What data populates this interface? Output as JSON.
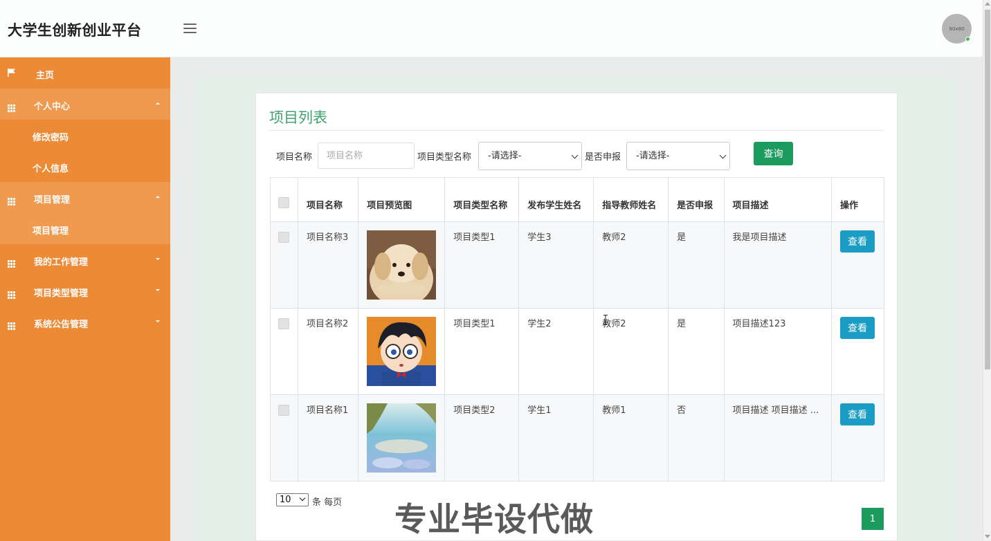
{
  "header": {
    "brand": "大学生创新创业平台",
    "avatar_text": "80x80"
  },
  "sidebar": {
    "items": [
      {
        "label": "主页",
        "icon": "flag-icon"
      },
      {
        "label": "个人中心",
        "icon": "grid-icon",
        "expanded": true,
        "children": [
          "修改密码",
          "个人信息"
        ]
      },
      {
        "label": "项目管理",
        "icon": "grid-icon",
        "expanded": true,
        "children": [
          "项目管理"
        ]
      },
      {
        "label": "我的工作管理",
        "icon": "grid-icon",
        "expanded": false
      },
      {
        "label": "项目类型管理",
        "icon": "grid-icon",
        "expanded": false
      },
      {
        "label": "系统公告管理",
        "icon": "grid-icon",
        "expanded": false
      }
    ]
  },
  "main": {
    "title": "项目列表",
    "search": {
      "name_label": "项目名称",
      "name_placeholder": "项目名称",
      "type_label": "项目类型名称",
      "type_select": "-请选择-",
      "declared_label": "是否申报",
      "declared_select": "-请选择-",
      "query_button": "查询"
    },
    "table": {
      "headers": [
        "项目名称",
        "项目预览图",
        "项目类型名称",
        "发布学生姓名",
        "指导教师姓名",
        "是否申报",
        "项目描述",
        "操作"
      ],
      "rows": [
        {
          "name": "项目名称3",
          "image": "puppy-photo",
          "type": "项目类型1",
          "student": "学生3",
          "teacher": "教师2",
          "declared": "是",
          "desc": "我是项目描述",
          "action": "查看"
        },
        {
          "name": "项目名称2",
          "image": "cartoon-boy-photo",
          "type": "项目类型1",
          "student": "学生2",
          "teacher": "教师2",
          "declared": "是",
          "desc": "项目描述123",
          "action": "查看"
        },
        {
          "name": "项目名称1",
          "image": "beach-photo",
          "type": "项目类型2",
          "student": "学生1",
          "teacher": "教师1",
          "declared": "否",
          "desc": "项目描述 项目描述 ...",
          "action": "查看"
        }
      ]
    },
    "pager": {
      "page_size": "10",
      "per_page_text": "条 每页",
      "current_page": "1"
    }
  },
  "overlay": {
    "watermark": "专业毕设代做"
  },
  "colors": {
    "sidebar": "#ed8a36",
    "sidebar_open": "#f09a4f",
    "title_green": "#3da36d",
    "query_button": "#1c9b5e",
    "view_button": "#1b9cc4"
  }
}
